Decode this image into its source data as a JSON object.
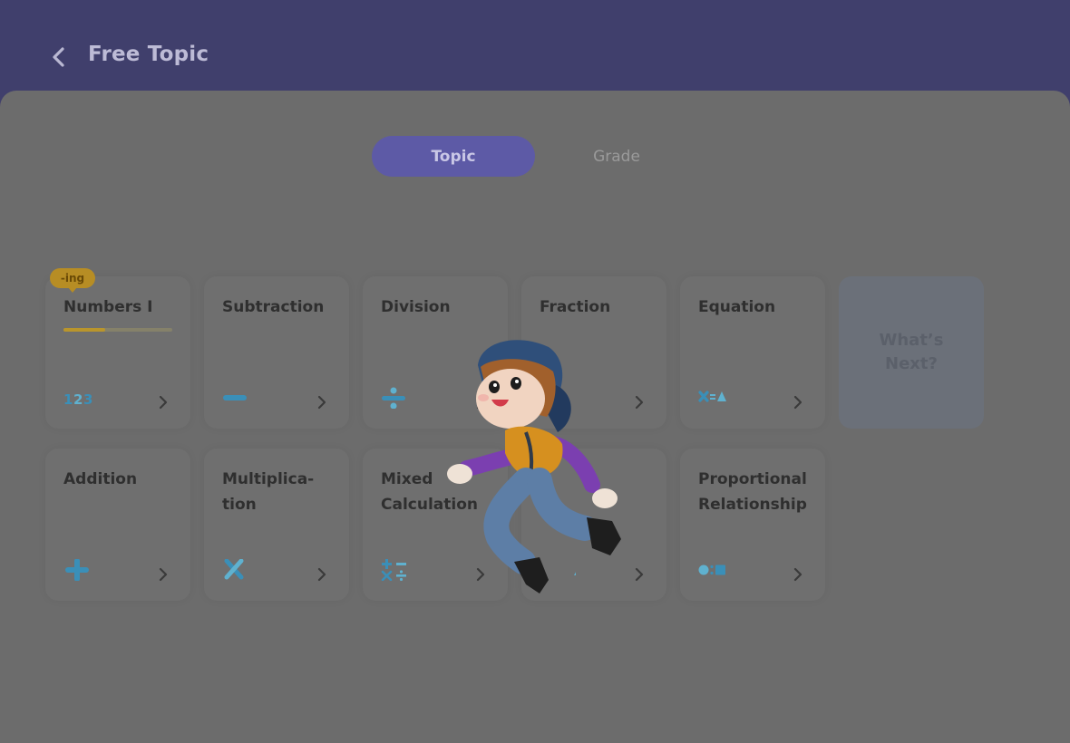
{
  "header": {
    "title": "Free Topic"
  },
  "tabs": {
    "topic": "Topic",
    "grade": "Grade"
  },
  "badge": {
    "in_progress": "-ing"
  },
  "cards": {
    "numbers": {
      "title": "Numbers I",
      "progress": 0.38,
      "icon": "numbers-123-icon"
    },
    "subtraction": {
      "title": "Subtraction",
      "icon": "minus-icon"
    },
    "division": {
      "title": "Division",
      "icon": "divide-icon"
    },
    "fraction": {
      "title": "Fraction",
      "icon": "fraction-icon"
    },
    "equation": {
      "title": "Equation",
      "icon": "equation-icon"
    },
    "addition": {
      "title": "Addition",
      "icon": "plus-icon"
    },
    "multiplication": {
      "title": "Multiplica-\ntion",
      "icon": "times-icon"
    },
    "mixed": {
      "title": "Mixed Calculation",
      "icon": "mixed-operations-icon"
    },
    "geometry": {
      "title": "",
      "icon": "shapes-icon"
    },
    "proportional": {
      "title": "Proportional Relationship",
      "icon": "ratio-icon"
    }
  },
  "whats_next": "What’s Next?",
  "colors": {
    "header": "#403f6c",
    "overlay_panel": "#6c6c6c",
    "active_tab": "#5d5aa6",
    "accent_icon": "#3a8fb8",
    "badge": "#b78d24"
  }
}
